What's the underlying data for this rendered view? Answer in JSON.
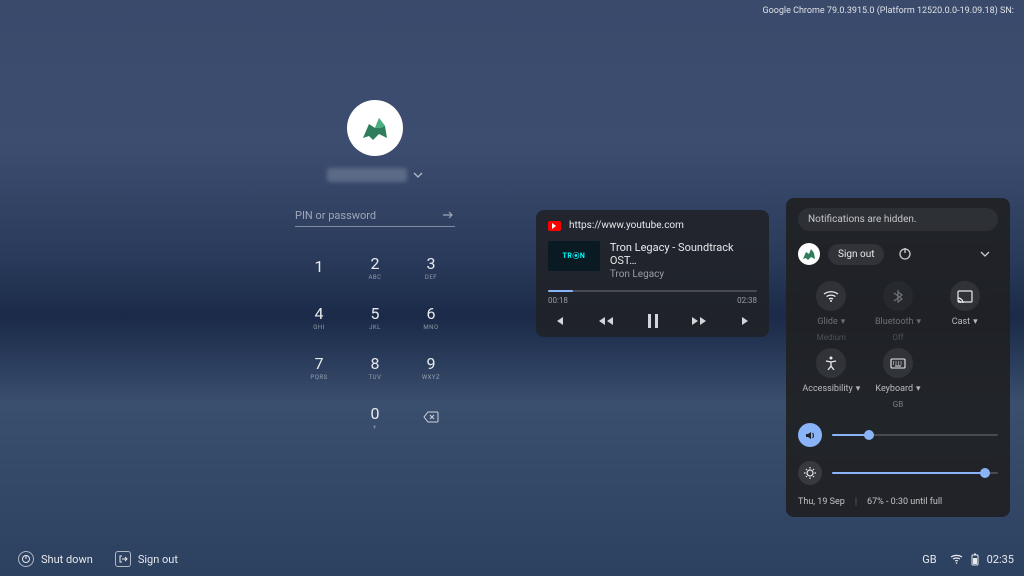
{
  "build_info": "Google Chrome 79.0.3915.0 (Platform 12520.0.0-19.09.18) SN:",
  "login": {
    "pin_placeholder": "PIN or password",
    "keypad": [
      {
        "digit": "1",
        "letters": ""
      },
      {
        "digit": "2",
        "letters": "ABC"
      },
      {
        "digit": "3",
        "letters": "DEF"
      },
      {
        "digit": "4",
        "letters": "GHI"
      },
      {
        "digit": "5",
        "letters": "JKL"
      },
      {
        "digit": "6",
        "letters": "MNO"
      },
      {
        "digit": "7",
        "letters": "PQRS"
      },
      {
        "digit": "8",
        "letters": "TUV"
      },
      {
        "digit": "9",
        "letters": "WXYZ"
      },
      {
        "digit": "0",
        "letters": "+"
      }
    ]
  },
  "bottom": {
    "shutdown": "Shut down",
    "signout": "Sign out"
  },
  "tray": {
    "kb_layout": "GB",
    "time": "02:35"
  },
  "media": {
    "source": "https://www.youtube.com",
    "title": "Tron Legacy - Soundtrack OST…",
    "artist": "Tron Legacy",
    "elapsed": "00:18",
    "total": "02:38",
    "progress_pct": 12
  },
  "qs": {
    "notif_text": "Notifications are hidden.",
    "signout": "Sign out",
    "tiles": [
      {
        "name": "wifi",
        "label": "Glide",
        "sub": "Medium",
        "dim": true
      },
      {
        "name": "bluetooth",
        "label": "Bluetooth",
        "sub": "Off",
        "dim": true
      },
      {
        "name": "cast",
        "label": "Cast",
        "sub": "",
        "dim": false
      },
      {
        "name": "accessibility",
        "label": "Accessibility",
        "sub": "",
        "dim": false
      },
      {
        "name": "keyboard",
        "label": "Keyboard",
        "sub": "GB",
        "dim": false
      }
    ],
    "volume_pct": 22,
    "brightness_pct": 92,
    "date": "Thu, 19 Sep",
    "battery": "67% - 0:30 until full"
  }
}
